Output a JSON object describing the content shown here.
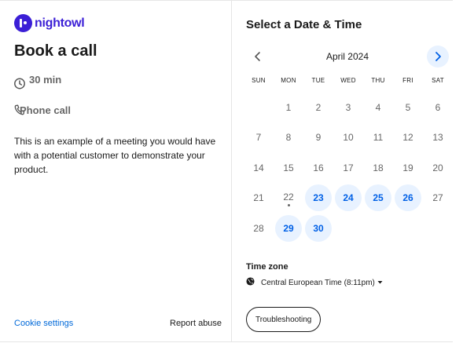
{
  "brand": {
    "name": "nightowl",
    "color": "#3b1fd6"
  },
  "event": {
    "title": "Book a call",
    "duration": "30 min",
    "location": "Phone call",
    "description": "This is an example of a meeting you would have with a potential customer to demonstrate your product."
  },
  "footer": {
    "cookie_settings": "Cookie settings",
    "report_abuse": "Report abuse"
  },
  "scheduler": {
    "heading": "Select a Date & Time",
    "month": "April 2024",
    "weekdays": [
      "SUN",
      "MON",
      "TUE",
      "WED",
      "THU",
      "FRI",
      "SAT"
    ],
    "weeks": [
      [
        "",
        "1",
        "2",
        "3",
        "4",
        "5",
        "6"
      ],
      [
        "7",
        "8",
        "9",
        "10",
        "11",
        "12",
        "13"
      ],
      [
        "14",
        "15",
        "16",
        "17",
        "18",
        "19",
        "20"
      ],
      [
        "21",
        "22",
        "23",
        "24",
        "25",
        "26",
        "27"
      ],
      [
        "28",
        "29",
        "30",
        "",
        "",
        "",
        ""
      ]
    ],
    "available_days": [
      "23",
      "24",
      "25",
      "26",
      "29",
      "30"
    ],
    "today": "22",
    "accent_color": "#0060e6",
    "available_bg": "#e8f2ff"
  },
  "timezone": {
    "label": "Time zone",
    "value": "Central European Time (8:11pm)"
  },
  "troubleshooting": "Troubleshooting",
  "icons": {
    "brand": "nightowl-logo-icon",
    "duration": "clock-icon",
    "location": "phone-icon",
    "prev": "chevron-left-icon",
    "next": "chevron-right-icon",
    "timezone": "globe-icon",
    "dropdown": "caret-down-icon"
  }
}
